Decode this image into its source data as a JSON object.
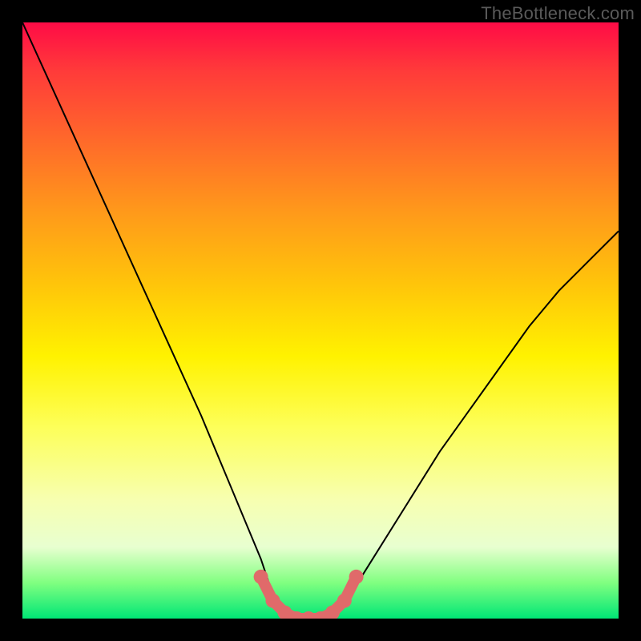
{
  "watermark": "TheBottleneck.com",
  "chart_data": {
    "type": "line",
    "title": "",
    "xlabel": "",
    "ylabel": "",
    "xlim": [
      0,
      100
    ],
    "ylim": [
      0,
      100
    ],
    "gradient_colors_top_to_bottom": [
      "#ff0b46",
      "#ff6a2a",
      "#ffc50a",
      "#fff200",
      "#fdff5a",
      "#80ff80",
      "#00e676"
    ],
    "series": [
      {
        "name": "bottleneck-curve",
        "x": [
          0,
          5,
          10,
          15,
          20,
          25,
          30,
          35,
          40,
          42,
          44,
          46,
          48,
          50,
          52,
          55,
          60,
          65,
          70,
          75,
          80,
          85,
          90,
          95,
          100
        ],
        "values": [
          100,
          89,
          78,
          67,
          56,
          45,
          34,
          22,
          10,
          4,
          1,
          0,
          0,
          0,
          1,
          4,
          12,
          20,
          28,
          35,
          42,
          49,
          55,
          60,
          65
        ]
      }
    ],
    "annotations": [
      {
        "name": "trough-highlight",
        "type": "marker-run",
        "color": "#e06a6a",
        "x": [
          40,
          42,
          44,
          46,
          48,
          50,
          52,
          54,
          56
        ],
        "values": [
          7,
          3,
          1,
          0,
          0,
          0,
          1,
          3,
          7
        ]
      }
    ]
  }
}
